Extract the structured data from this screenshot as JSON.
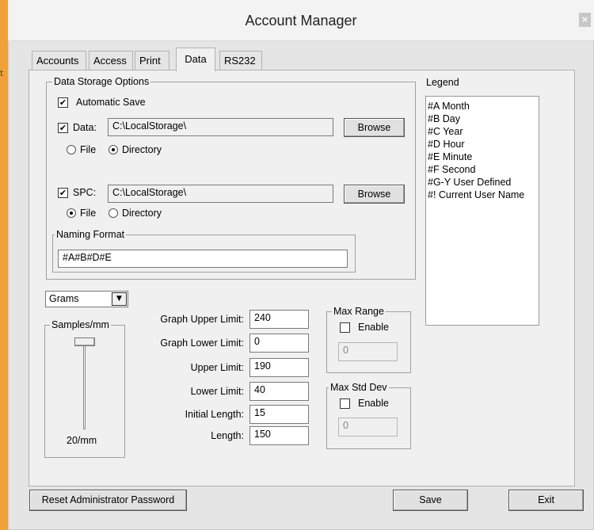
{
  "window": {
    "title": "Account Manager",
    "close_glyph": "×"
  },
  "stray_char": "t",
  "tabs": [
    {
      "label": "Accounts"
    },
    {
      "label": "Access"
    },
    {
      "label": "Print"
    },
    {
      "label": "Data"
    },
    {
      "label": "RS232"
    }
  ],
  "storage": {
    "group_label": "Data Storage Options",
    "automatic_save": {
      "label": "Automatic Save",
      "checked": true
    },
    "data": {
      "label": "Data:",
      "path": "C:\\LocalStorage\\",
      "browse": "Browse",
      "file": "File",
      "directory": "Directory",
      "selected": "Directory"
    },
    "spc": {
      "label": "SPC:",
      "path": "C:\\LocalStorage\\",
      "browse": "Browse",
      "file": "File",
      "directory": "Directory",
      "selected": "File"
    },
    "naming": {
      "label": "Naming Format",
      "value": "#A#B#D#E"
    }
  },
  "legend": {
    "label": "Legend",
    "items": [
      "#A Month",
      "#B Day",
      "#C Year",
      "#D Hour",
      "#E Minute",
      "#F Second",
      "#G-Y User Defined",
      "#! Current User Name"
    ]
  },
  "units": {
    "selected": "Grams"
  },
  "samples": {
    "label": "Samples/mm",
    "value": "20/mm",
    "slider_level": 1.0
  },
  "limits": [
    {
      "label": "Graph Upper Limit:",
      "value": "240"
    },
    {
      "label": "Graph Lower Limit:",
      "value": "0"
    },
    {
      "label": "Upper Limit:",
      "value": "190"
    },
    {
      "label": "Lower Limit:",
      "value": "40"
    },
    {
      "label": "Initial Length:",
      "value": "15"
    },
    {
      "label": "Length:",
      "value": "150"
    }
  ],
  "max_range": {
    "label": "Max Range",
    "enable": "Enable",
    "checked": false,
    "value": "0"
  },
  "max_std_dev": {
    "label": "Max Std Dev",
    "enable": "Enable",
    "checked": false,
    "value": "0"
  },
  "footer": {
    "reset": "Reset Administrator Password",
    "save": "Save",
    "exit": "Exit"
  },
  "colors": {
    "accent": "#f0a23a",
    "window_bg": "#f0f0f0"
  }
}
